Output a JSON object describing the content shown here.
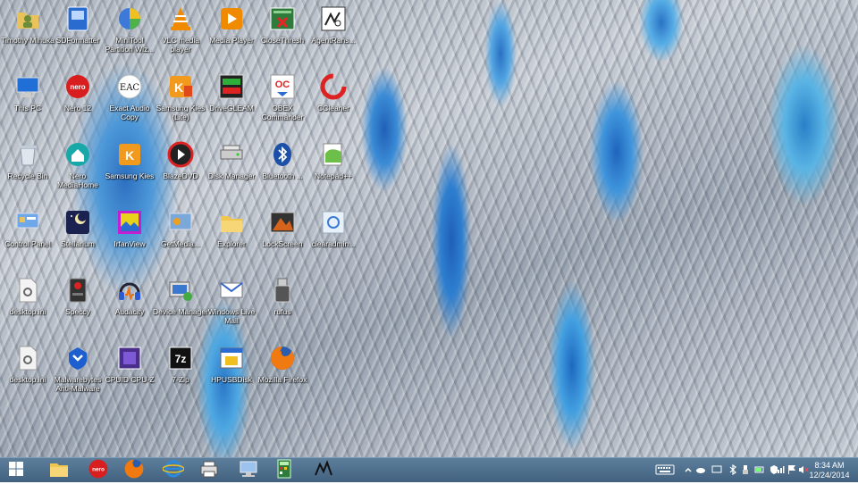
{
  "desktop": {
    "icons": [
      {
        "name": "Timothy Mihuka",
        "icon": "folder-user-icon"
      },
      {
        "name": "SDFormatter",
        "icon": "sdformatter-icon"
      },
      {
        "name": "MiniTool Partition Wiz...",
        "icon": "minitool-icon"
      },
      {
        "name": "VLC media player",
        "icon": "vlc-icon"
      },
      {
        "name": "Media Player",
        "icon": "media-player-icon"
      },
      {
        "name": "CloseThresh",
        "icon": "closethresh-icon"
      },
      {
        "name": "AgentRans...",
        "icon": "agentrans-icon"
      },
      {
        "name": "This PC",
        "icon": "this-pc-icon"
      },
      {
        "name": "Nero 12",
        "icon": "nero-icon"
      },
      {
        "name": "Exact Audio Copy",
        "icon": "eac-icon"
      },
      {
        "name": "Samsung Kies (Lite)",
        "icon": "kies-lite-icon"
      },
      {
        "name": "DriveGLEAM",
        "icon": "driveglean-icon"
      },
      {
        "name": "OBEX Commander",
        "icon": "obex-icon"
      },
      {
        "name": "CCleaner",
        "icon": "ccleaner-icon"
      },
      {
        "name": "Recycle Bin",
        "icon": "recycle-bin-icon"
      },
      {
        "name": "Nero MediaHome",
        "icon": "nero-mediahome-icon"
      },
      {
        "name": "Samsung Kies",
        "icon": "kies-icon"
      },
      {
        "name": "BlazeDVD",
        "icon": "blazedvd-icon"
      },
      {
        "name": "Disk Manager",
        "icon": "disk-manager-icon"
      },
      {
        "name": "Bluetooth ...",
        "icon": "bluetooth-icon"
      },
      {
        "name": "Notepad++",
        "icon": "notepadpp-icon"
      },
      {
        "name": "Control Panel",
        "icon": "control-panel-icon"
      },
      {
        "name": "Stellarium",
        "icon": "stellarium-icon"
      },
      {
        "name": "IrfanView",
        "icon": "irfanview-icon"
      },
      {
        "name": "GetMedia...",
        "icon": "getmedia-icon"
      },
      {
        "name": "Explorer",
        "icon": "explorer-folder-icon"
      },
      {
        "name": "LockScreen",
        "icon": "lockscreen-icon"
      },
      {
        "name": "clearadmin...",
        "icon": "clearadmin-icon"
      },
      {
        "name": "desktop.ini",
        "icon": "ini-file-icon"
      },
      {
        "name": "Speccy",
        "icon": "speccy-icon"
      },
      {
        "name": "Audacity",
        "icon": "audacity-icon"
      },
      {
        "name": "Device Manager",
        "icon": "device-manager-icon"
      },
      {
        "name": "Windows Live Mail",
        "icon": "live-mail-icon"
      },
      {
        "name": "rufus",
        "icon": "rufus-icon"
      },
      {
        "name": "desktop.ini",
        "icon": "ini-file-icon"
      },
      {
        "name": "Malwarebytes Anti-Malware",
        "icon": "malwarebytes-icon"
      },
      {
        "name": "CPUID CPU-Z",
        "icon": "cpuz-icon"
      },
      {
        "name": "7-Zip",
        "icon": "sevenzip-icon"
      },
      {
        "name": "HPUSBDisk",
        "icon": "hpusbdisk-icon"
      },
      {
        "name": "Mozilla Firefox",
        "icon": "firefox-icon"
      }
    ]
  },
  "taskbar": {
    "pinned": [
      {
        "icon": "start-icon"
      },
      {
        "icon": "file-explorer-icon"
      },
      {
        "icon": "nero-icon"
      },
      {
        "icon": "firefox-icon"
      },
      {
        "icon": "internet-explorer-icon"
      },
      {
        "icon": "printer-icon"
      },
      {
        "icon": "network-pc-icon"
      },
      {
        "icon": "calculator-icon"
      },
      {
        "icon": "script-icon"
      }
    ],
    "tray": [
      {
        "icon": "keyboard-icon"
      },
      {
        "icon": "chevron-up-icon"
      },
      {
        "icon": "onedrive-icon"
      },
      {
        "icon": "display-icon"
      },
      {
        "icon": "bluetooth-icon"
      },
      {
        "icon": "usb-icon"
      },
      {
        "icon": "battery-icon"
      },
      {
        "icon": "shield-icon"
      },
      {
        "icon": "signal-icon"
      },
      {
        "icon": "flag-icon"
      },
      {
        "icon": "volume-muted-icon"
      }
    ],
    "clock": {
      "time": "8:34 AM",
      "date": "12/24/2014"
    }
  }
}
